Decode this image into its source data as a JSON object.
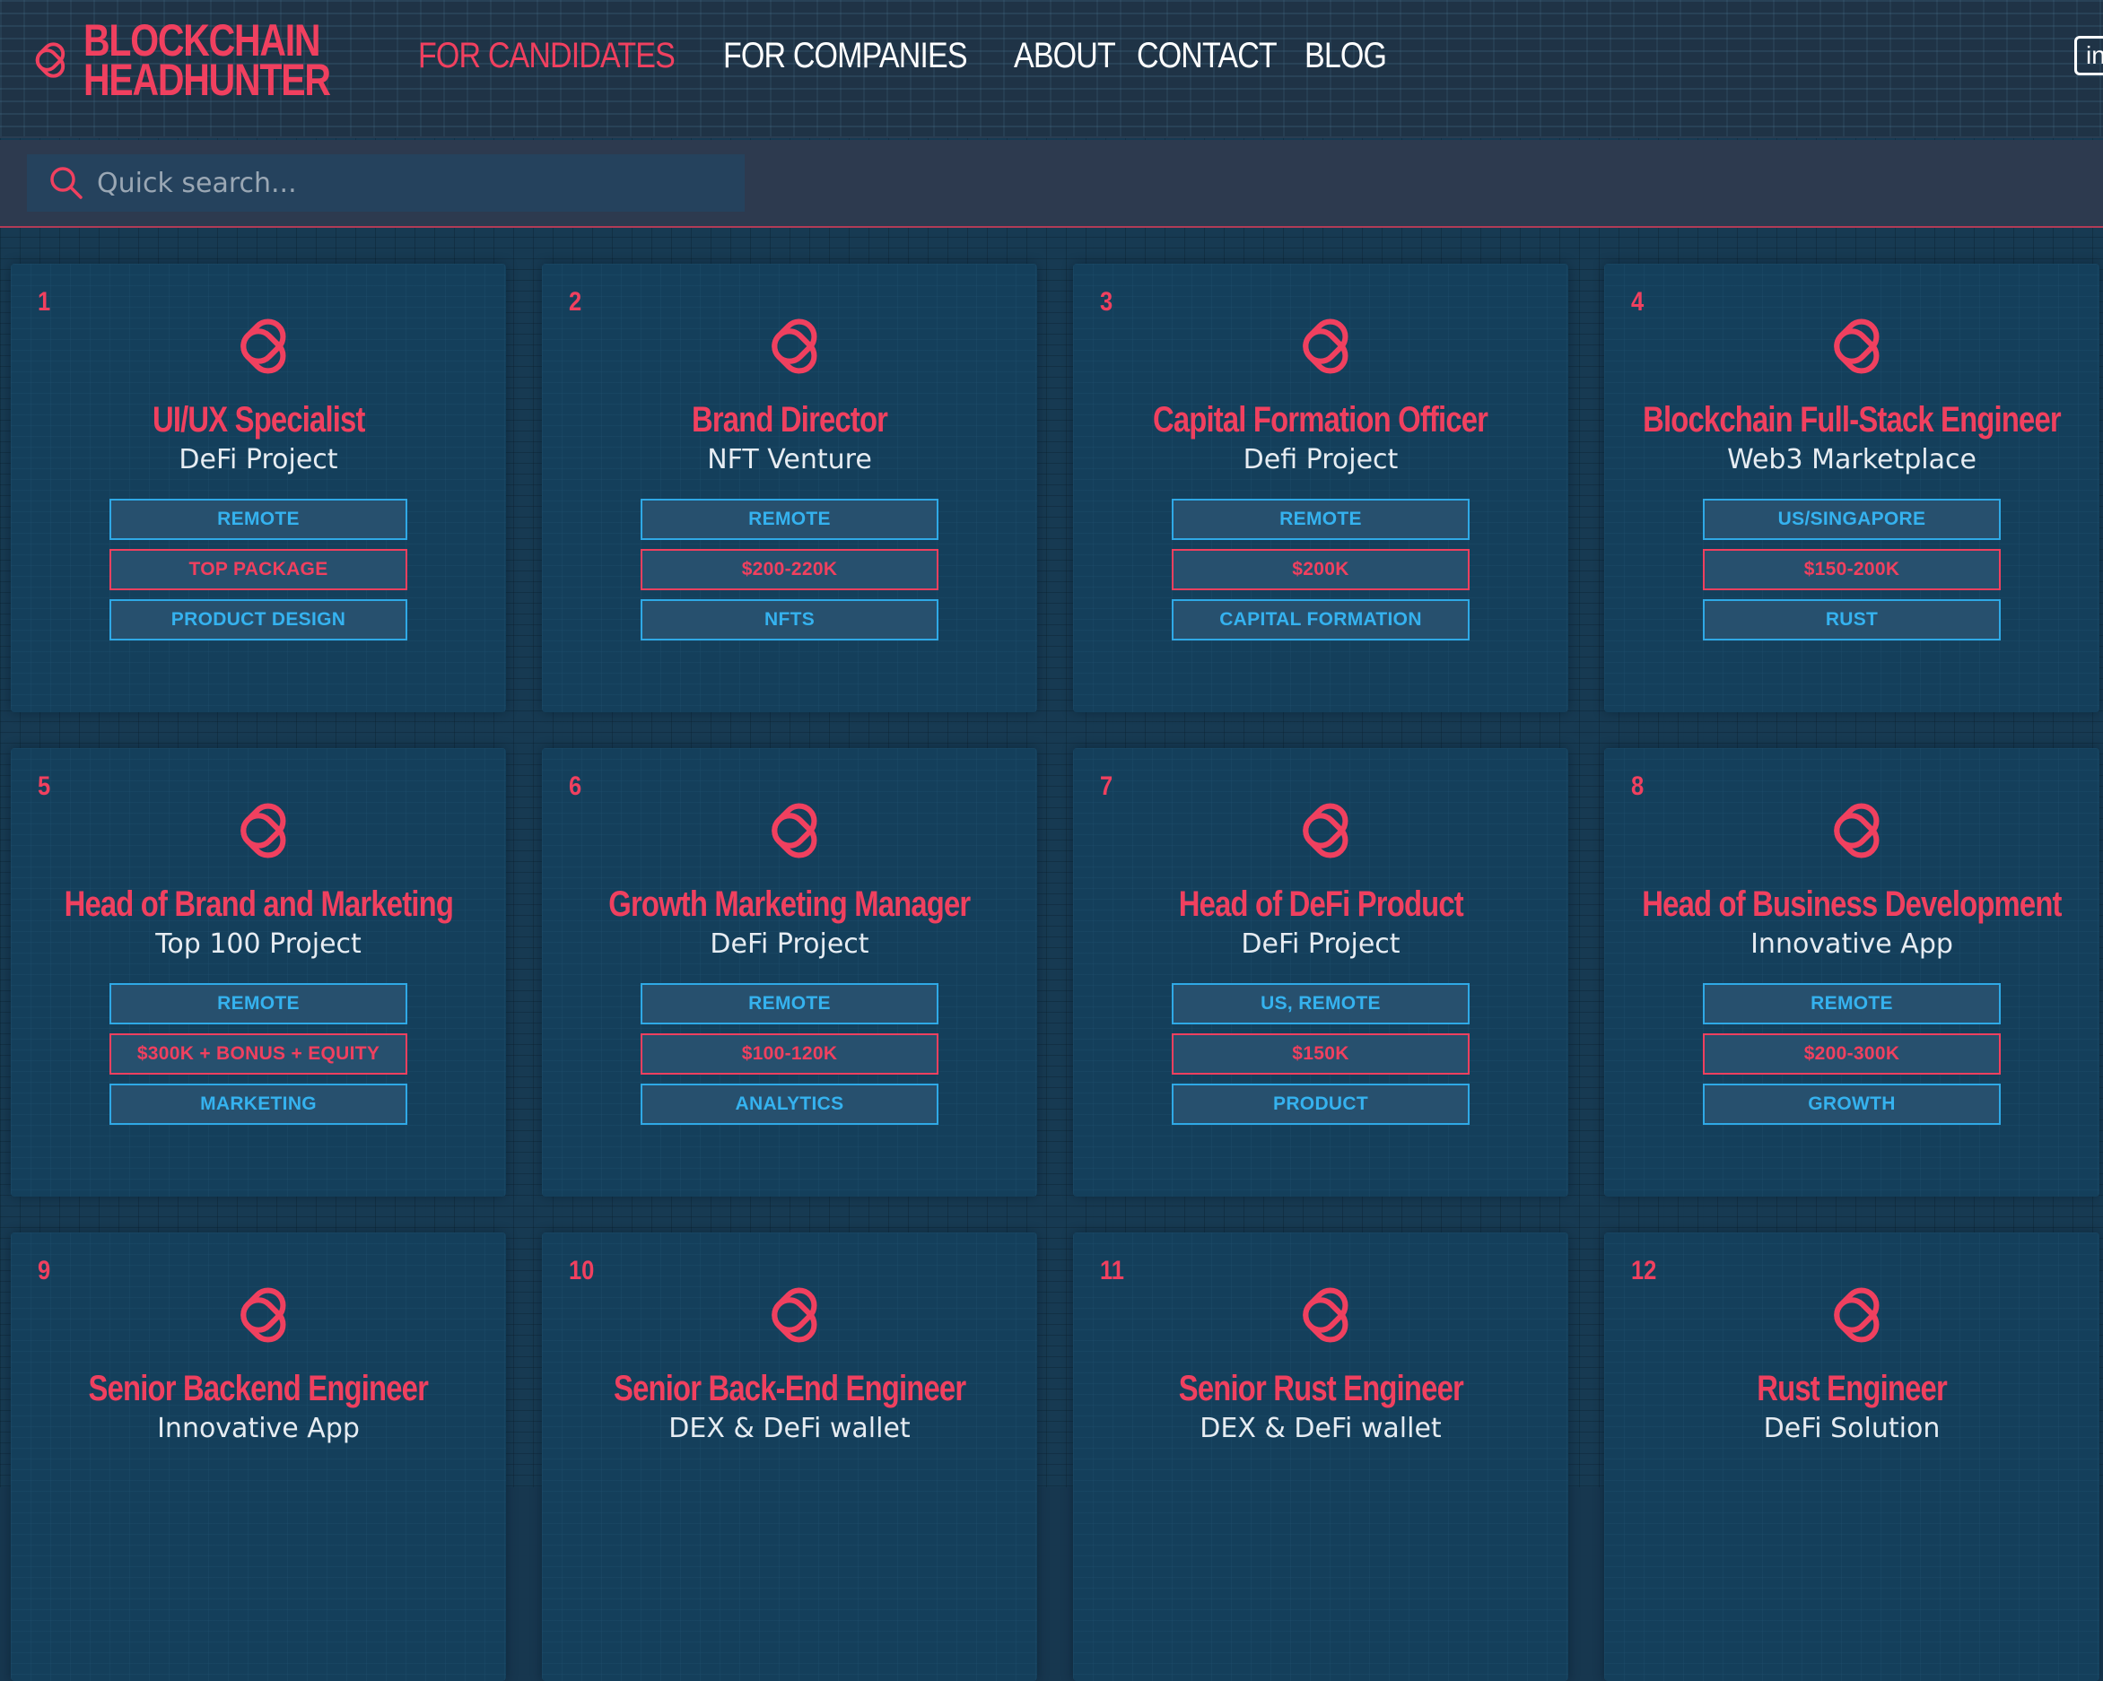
{
  "brand": {
    "line1": "BLOCKCHAIN",
    "line2": "HEADHUNTER"
  },
  "nav": {
    "items": [
      {
        "label": "FOR CANDIDATES",
        "active": true
      },
      {
        "label": "FOR COMPANIES",
        "active": false
      },
      {
        "label": "ABOUT",
        "active": false
      },
      {
        "label": "CONTACT",
        "active": false
      },
      {
        "label": "BLOG",
        "active": false
      }
    ],
    "social": "in"
  },
  "search": {
    "placeholder": "Quick search..."
  },
  "colors": {
    "accent": "#f0405f",
    "tag_blue": "#35b2ef",
    "card_bg": "#143f5b"
  },
  "jobs": [
    {
      "num": "1",
      "title": "UI/UX Specialist",
      "company": "DeFi Project",
      "tags": [
        {
          "text": "REMOTE",
          "style": "blue"
        },
        {
          "text": "TOP PACKAGE",
          "style": "red"
        },
        {
          "text": "PRODUCT DESIGN",
          "style": "blue"
        }
      ]
    },
    {
      "num": "2",
      "title": "Brand Director",
      "company": "NFT Venture",
      "tags": [
        {
          "text": "REMOTE",
          "style": "blue"
        },
        {
          "text": "$200-220K",
          "style": "red"
        },
        {
          "text": "NFTS",
          "style": "blue"
        }
      ]
    },
    {
      "num": "3",
      "title": "Capital Formation Officer",
      "company": "Defi Project",
      "tags": [
        {
          "text": "REMOTE",
          "style": "blue"
        },
        {
          "text": "$200K",
          "style": "red"
        },
        {
          "text": "CAPITAL FORMATION",
          "style": "blue"
        }
      ]
    },
    {
      "num": "4",
      "title": "Blockchain Full-Stack Engineer",
      "company": "Web3 Marketplace",
      "tags": [
        {
          "text": "US/SINGAPORE",
          "style": "blue"
        },
        {
          "text": "$150-200K",
          "style": "red"
        },
        {
          "text": "RUST",
          "style": "blue"
        }
      ]
    },
    {
      "num": "5",
      "title": "Head of Brand and Marketing",
      "company": "Top 100 Project",
      "tags": [
        {
          "text": "REMOTE",
          "style": "blue"
        },
        {
          "text": "$300K + BONUS + EQUITY",
          "style": "red"
        },
        {
          "text": "MARKETING",
          "style": "blue"
        }
      ]
    },
    {
      "num": "6",
      "title": "Growth Marketing Manager",
      "company": "DeFi Project",
      "tags": [
        {
          "text": "REMOTE",
          "style": "blue"
        },
        {
          "text": "$100-120K",
          "style": "red"
        },
        {
          "text": "ANALYTICS",
          "style": "blue"
        }
      ]
    },
    {
      "num": "7",
      "title": "Head of DeFi Product",
      "company": "DeFi Project",
      "tags": [
        {
          "text": "US, REMOTE",
          "style": "blue"
        },
        {
          "text": "$150K",
          "style": "red"
        },
        {
          "text": "PRODUCT",
          "style": "blue"
        }
      ]
    },
    {
      "num": "8",
      "title": "Head of Business Development",
      "company": "Innovative App",
      "tags": [
        {
          "text": "REMOTE",
          "style": "blue"
        },
        {
          "text": "$200-300K",
          "style": "red"
        },
        {
          "text": "GROWTH",
          "style": "blue"
        }
      ]
    },
    {
      "num": "9",
      "title": "Senior Backend Engineer",
      "company": "Innovative App",
      "tags": []
    },
    {
      "num": "10",
      "title": "Senior Back-End Engineer",
      "company": "DEX & DeFi wallet",
      "tags": []
    },
    {
      "num": "11",
      "title": "Senior Rust Engineer",
      "company": "DEX & DeFi wallet",
      "tags": []
    },
    {
      "num": "12",
      "title": "Rust Engineer",
      "company": "DeFi Solution",
      "tags": []
    }
  ]
}
